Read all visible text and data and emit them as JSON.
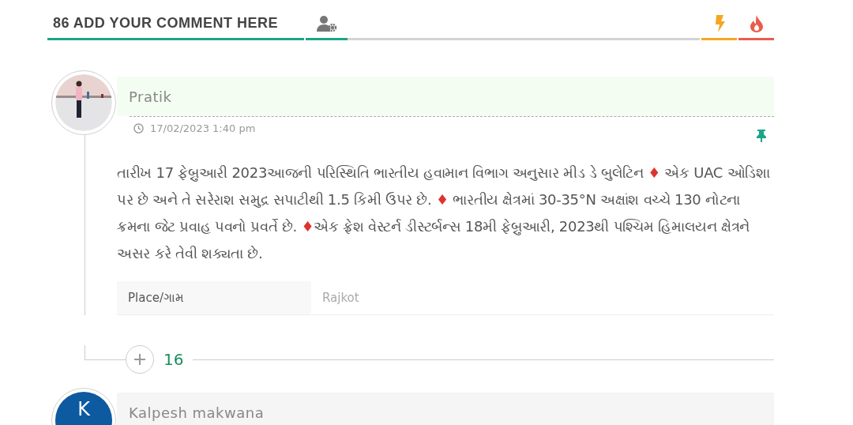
{
  "header": {
    "title": "86 ADD YOUR COMMENT HERE",
    "tabs": [
      {
        "kind": "bolt",
        "color": "#f5a623"
      },
      {
        "kind": "flame",
        "color": "#e95c4b"
      }
    ]
  },
  "comments": [
    {
      "author": "Pratik",
      "avatar": {
        "kind": "picture"
      },
      "highlighted": true,
      "date": "17/02/2023 1:40 pm",
      "pinned": true,
      "body": [
        {
          "kind": "text",
          "text": "તારીખ 17 ફેબ્રુઆરી 2023આજની પરિસ્થિતિ ભારતીય હવામાન વિભાગ અનુસાર મીડ ડે બુલેટિન "
        },
        {
          "kind": "diamond",
          "text": "♦"
        },
        {
          "kind": "text",
          "text": " એક UAC ઓડિશા પર છે અને તે સરેરાશ સમુદ્ર સપાટીથી 1.5 કિમી ઉપર છે.  "
        },
        {
          "kind": "diamond",
          "text": "♦"
        },
        {
          "kind": "text",
          "text": " ભારતીય ક્ષેત્રમાં 30-35°N અક્ષાંશ વચ્ચે 130 નોટના ક્રમના જેટ પ્રવાહ પવનો પ્રવર્તે છે.  "
        },
        {
          "kind": "diamond",
          "text": "♦"
        },
        {
          "kind": "text",
          "text": "એક ફ્રેશ વેસ્ટર્ન ડીસ્ટર્બન્સ 18મી ફેબ્રુઆરી, 2023થી પશ્ચિમ હિમાલયન ક્ષેત્રને અસર કરે તેવી શક્યતા છે."
        }
      ],
      "fields": [
        {
          "label": "Place/ગામ",
          "value": "Rajkot"
        }
      ],
      "votes": "16"
    },
    {
      "author": "Kalpesh makwana",
      "avatar": {
        "kind": "letter",
        "letter": "K"
      },
      "highlighted": false
    }
  ]
}
